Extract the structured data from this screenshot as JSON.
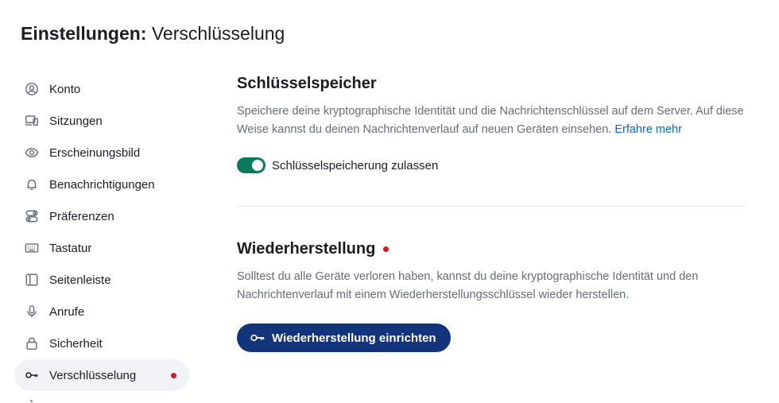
{
  "header": {
    "title_bold": "Einstellungen:",
    "title_light": "Verschlüsselung"
  },
  "sidebar": {
    "items": [
      {
        "label": "Konto",
        "icon": "user-circle-icon"
      },
      {
        "label": "Sitzungen",
        "icon": "devices-icon"
      },
      {
        "label": "Erscheinungsbild",
        "icon": "eye-icon"
      },
      {
        "label": "Benachrichtigungen",
        "icon": "bell-icon"
      },
      {
        "label": "Präferenzen",
        "icon": "preferences-icon"
      },
      {
        "label": "Tastatur",
        "icon": "keyboard-icon"
      },
      {
        "label": "Seitenleiste",
        "icon": "sidebar-icon"
      },
      {
        "label": "Anrufe",
        "icon": "microphone-icon"
      },
      {
        "label": "Sicherheit",
        "icon": "lock-icon"
      },
      {
        "label": "Verschlüsselung",
        "icon": "key-icon",
        "active": true
      }
    ]
  },
  "key_storage": {
    "title": "Schlüsselspeicher",
    "description": "Speichere deine kryptographische Identität und die Nachrichtenschlüssel auf dem Server. Auf diese Weise kannst du deinen Nachrichtenverlauf auf neuen Geräten einsehen.",
    "learn_more": "Erfahre mehr",
    "toggle_label": "Schlüsselspeicherung zulassen",
    "toggle_on": true
  },
  "recovery": {
    "title": "Wiederherstellung",
    "description": "Solltest du alle Geräte verloren haben, kannst du deine kryptographische Identität und den Nachrichtenverlauf mit einem Wiederherstellungsschlüssel wieder herstellen.",
    "button_label": "Wiederherstellung einrichten"
  },
  "colors": {
    "accent_green": "#0b7a5a",
    "primary_button": "#12347a",
    "alert_dot": "#d51928",
    "link": "#0467dd"
  }
}
